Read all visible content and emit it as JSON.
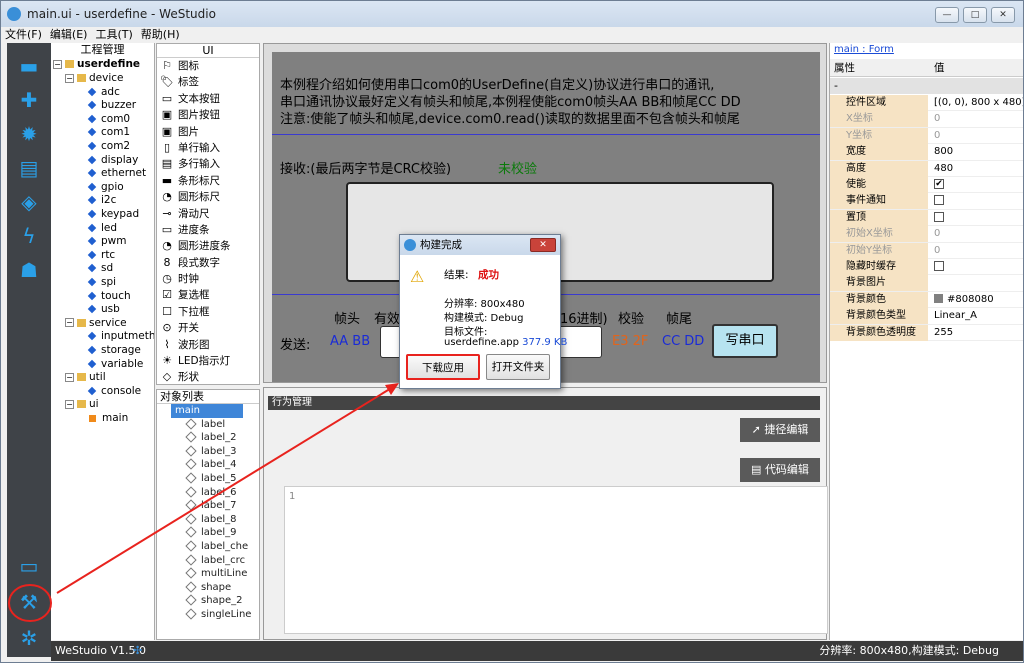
{
  "window": {
    "title": "main.ui - userdefine - WeStudio"
  },
  "menu": [
    "文件(F)",
    "编辑(E)",
    "工具(T)",
    "帮助(H)"
  ],
  "project": {
    "header": "工程管理",
    "root": "userdefine",
    "folders": [
      {
        "name": "device",
        "items": [
          "adc",
          "buzzer",
          "com0",
          "com1",
          "com2",
          "display",
          "ethernet",
          "gpio",
          "i2c",
          "keypad",
          "led",
          "pwm",
          "rtc",
          "sd",
          "spi",
          "touch",
          "usb"
        ]
      },
      {
        "name": "service",
        "items": [
          "inputmethod",
          "storage",
          "variable"
        ]
      },
      {
        "name": "util",
        "items": [
          "console"
        ]
      },
      {
        "name": "ui",
        "items": [
          "main"
        ]
      }
    ]
  },
  "components": {
    "header": "UI",
    "items": [
      "图标",
      "标签",
      "文本按钮",
      "图片按钮",
      "图片",
      "单行输入",
      "多行输入",
      "条形标尺",
      "圆形标尺",
      "滑动尺",
      "进度条",
      "圆形进度条",
      "段式数字",
      "时钟",
      "复选框",
      "下拉框",
      "开关",
      "波形图",
      "LED指示灯",
      "形状"
    ]
  },
  "objects": {
    "header": "对象列表",
    "root": "main",
    "items": [
      "label",
      "label_2",
      "label_3",
      "label_4",
      "label_5",
      "label_6",
      "label_7",
      "label_8",
      "label_9",
      "label_che",
      "label_crc",
      "multiLine",
      "shape",
      "shape_2",
      "singleLine"
    ]
  },
  "canvas": {
    "line1": "本例程介绍如何使用串口com0的UserDefine(自定义)协议进行串口的通讯,",
    "line2": "串口通讯协议最好定义有帧头和帧尾,本例程使能com0帧头AA BB和帧尾CC DD",
    "line3": "注意:使能了帧头和帧尾,device.com0.read()读取的数据里面不包含帧头和帧尾",
    "recv_label": "接收:(最后两字节是CRC校验)",
    "crc_status": "未校验",
    "col_head": "帧头",
    "col_valid": "有效",
    "col_hex": "16进制)",
    "col_check": "校验",
    "col_tail": "帧尾",
    "send_label": "发送:",
    "head_val": "AA BB",
    "crc_val": "E3 2F",
    "tail_val": "CC DD",
    "write_btn": "写串口"
  },
  "behavior": {
    "header": "行为管理",
    "shortcut_btn": "捷径编辑",
    "code_btn": "代码编辑",
    "line_no": "1"
  },
  "properties": {
    "link": "main : Form",
    "col_attr": "属性",
    "col_val": "值",
    "collapse": "-",
    "rows": [
      {
        "k": "控件区域",
        "v": "[(0, 0), 800 x 480]"
      },
      {
        "k": "X坐标",
        "v": "0"
      },
      {
        "k": "Y坐标",
        "v": "0"
      },
      {
        "k": "宽度",
        "v": "800"
      },
      {
        "k": "高度",
        "v": "480"
      },
      {
        "k": "使能",
        "v": "✔"
      },
      {
        "k": "事件通知",
        "v": ""
      },
      {
        "k": "置顶",
        "v": ""
      },
      {
        "k": "初始X坐标",
        "v": "0"
      },
      {
        "k": "初始Y坐标",
        "v": "0"
      },
      {
        "k": "隐藏时缓存",
        "v": ""
      },
      {
        "k": "背景图片",
        "v": ""
      },
      {
        "k": "背景颜色",
        "v": "#808080"
      },
      {
        "k": "背景颜色类型",
        "v": "Linear_A"
      },
      {
        "k": "背景颜色透明度",
        "v": "255"
      }
    ]
  },
  "status": {
    "version": "WeStudio V1.5.0",
    "right": "分辨率: 800x480,构建模式: Debug"
  },
  "dialog": {
    "title": "构建完成",
    "result_label": "结果:",
    "result_val": "成功",
    "resolution": "分辨率: 800x480",
    "mode": "构建模式: Debug",
    "target_label": "目标文件:",
    "file": "userdefine.app",
    "size": "377.9 KB",
    "btn_download": "下载应用",
    "btn_open": "打开文件夹"
  }
}
